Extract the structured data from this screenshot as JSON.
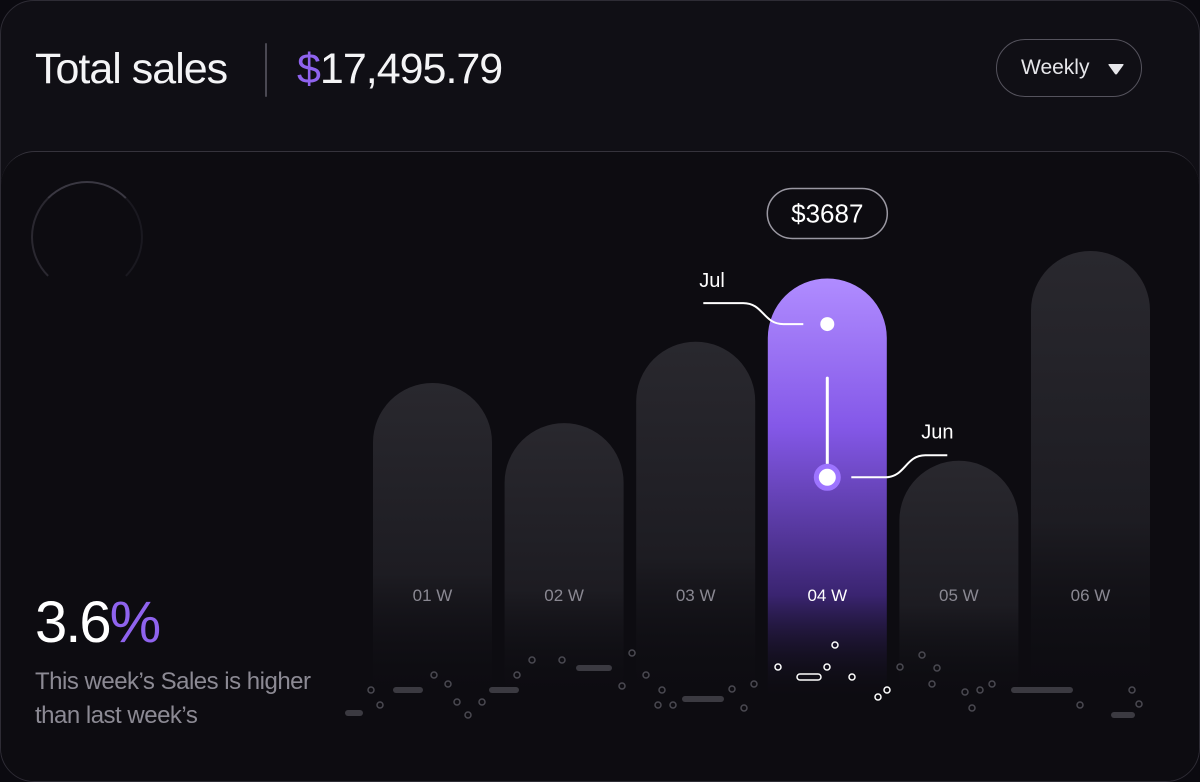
{
  "header": {
    "title": "Total sales",
    "currency_symbol": "$",
    "amount": "17,495.79",
    "period_select": {
      "selected": "Weekly",
      "icon": "caret-down-icon"
    }
  },
  "summary": {
    "percent_value": "3.6",
    "percent_symbol": "%",
    "note": "This week’s Sales is higher than last week’s"
  },
  "colors": {
    "accent": "#8f63ee",
    "bar": "#232228",
    "background": "#0b0a10"
  },
  "chart_data": {
    "type": "bar",
    "categories": [
      "01 W",
      "02 W",
      "03 W",
      "04 W",
      "05 W",
      "06 W"
    ],
    "values": [
      2800,
      2460,
      3150,
      3687,
      2140,
      3920
    ],
    "ylim": [
      0,
      4200
    ],
    "highlight_index": 3,
    "highlight_label": "$3687",
    "markers": [
      {
        "label": "Jul",
        "value": 3300
      },
      {
        "label": "Jun",
        "value": 2000
      }
    ]
  }
}
